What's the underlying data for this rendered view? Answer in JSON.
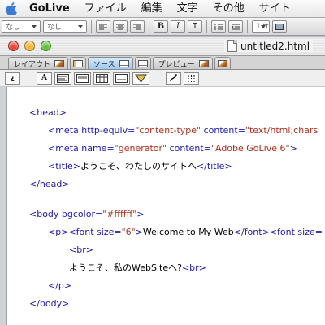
{
  "menubar": {
    "app": "GoLive",
    "items": [
      "ファイル",
      "編集",
      "文字",
      "その他",
      "サイト"
    ]
  },
  "toolbar": {
    "paragraph_format": "なし",
    "font_style": "なし",
    "bold": "B",
    "italic": "I",
    "teletype": "T",
    "size_field": "1.tt"
  },
  "window": {
    "title": "untitled2.html",
    "tabs": [
      {
        "label": "レイアウト",
        "active": false
      },
      {
        "label": "ソース",
        "active": true
      },
      {
        "label": "プレビュー",
        "active": false
      }
    ]
  },
  "source_toolbar": {
    "wrap_button": "¿",
    "text_button": "A",
    "help_button": "?"
  },
  "code": {
    "l1": {
      "open": "<head>"
    },
    "l2": {
      "tag": "<meta ",
      "a1": "http-equiv=",
      "v1": "\"content-type\"",
      "a2": " content=",
      "v2": "\"text/html;chars"
    },
    "l3": {
      "tag": "<meta ",
      "a1": "name=",
      "v1": "\"generator\"",
      "a2": " content=",
      "v2": "\"Adobe GoLive 6\"",
      "close": ">"
    },
    "l4": {
      "open": "<title>",
      "text": "ようこそ、わたしのサイトへ",
      "close": "</title>"
    },
    "l5": {
      "close": "</head>"
    },
    "l6": {
      "tag": "<body ",
      "a1": "bgcolor=",
      "v1": "\"#ffffff\"",
      "close": ">"
    },
    "l7": {
      "open": "<p><font ",
      "a1": "size=",
      "v1": "\"6\"",
      "mid": ">",
      "text": "Welcome to My Web",
      "close": "</font><font ",
      "a2": "size="
    },
    "l8": {
      "tag": "<br>"
    },
    "l9": {
      "text": "ようこそ、私のWebSiteへ?",
      "tag": "<br>"
    },
    "l10": {
      "tag": "</p>"
    },
    "l11": {
      "tag": "</body>"
    }
  },
  "colors": {
    "tag": "#1a1aa8",
    "value": "#a8321c",
    "close_light": "#e8463a",
    "minimize_light": "#f2b53a",
    "zoom_light": "#5fc23f"
  }
}
